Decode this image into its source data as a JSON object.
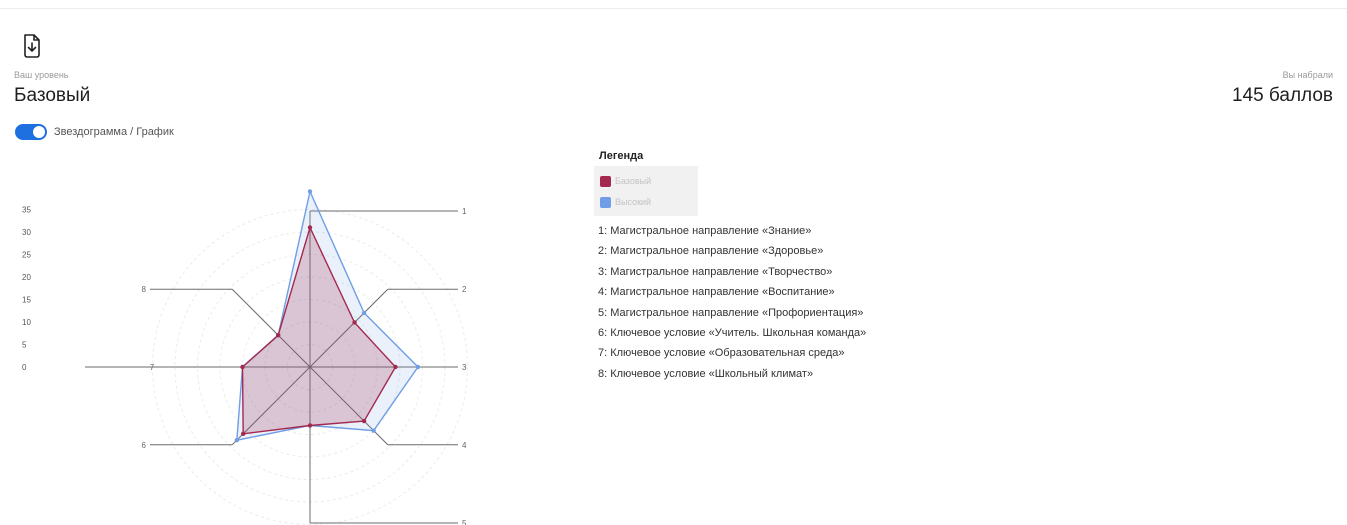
{
  "header": {
    "level_caption": "Ваш уровень",
    "level_value": "Базовый",
    "score_caption": "Вы набрали",
    "score_value": "145 баллов"
  },
  "toggle": {
    "label": "Звездограмма / График",
    "on": true
  },
  "legend": {
    "title": "Легенда",
    "series": [
      {
        "name": "Базовый",
        "color": "#a3294f"
      },
      {
        "name": "Высокий",
        "color": "#6f9ee6"
      }
    ]
  },
  "axis_descriptions": [
    "1: Магистральное направление «Знание»",
    "2: Магистральное направление «Здоровье»",
    "3: Магистральное направление «Творчество»",
    "4: Магистральное направление «Воспитание»",
    "5: Магистральное направление «Профориентация»",
    "6: Ключевое условие «Учитель. Школьная команда»",
    "7: Ключевое условие «Образовательная среда»",
    "8: Ключевое условие «Школьный климат»"
  ],
  "icons": {
    "download": "file-download-icon"
  },
  "chart_data": {
    "type": "radar",
    "categories": [
      "1",
      "2",
      "3",
      "4",
      "5",
      "6",
      "7",
      "8"
    ],
    "scale_ticks": [
      0,
      5,
      10,
      15,
      20,
      25,
      30,
      35
    ],
    "rmax": 40,
    "series": [
      {
        "name": "Базовый",
        "color": "#a3294f",
        "values": [
          31,
          14,
          19,
          17,
          13,
          21,
          15,
          10
        ]
      },
      {
        "name": "Высокий",
        "color": "#6f9ee6",
        "values": [
          39,
          17,
          24,
          20,
          13,
          23,
          15,
          10
        ]
      }
    ]
  }
}
